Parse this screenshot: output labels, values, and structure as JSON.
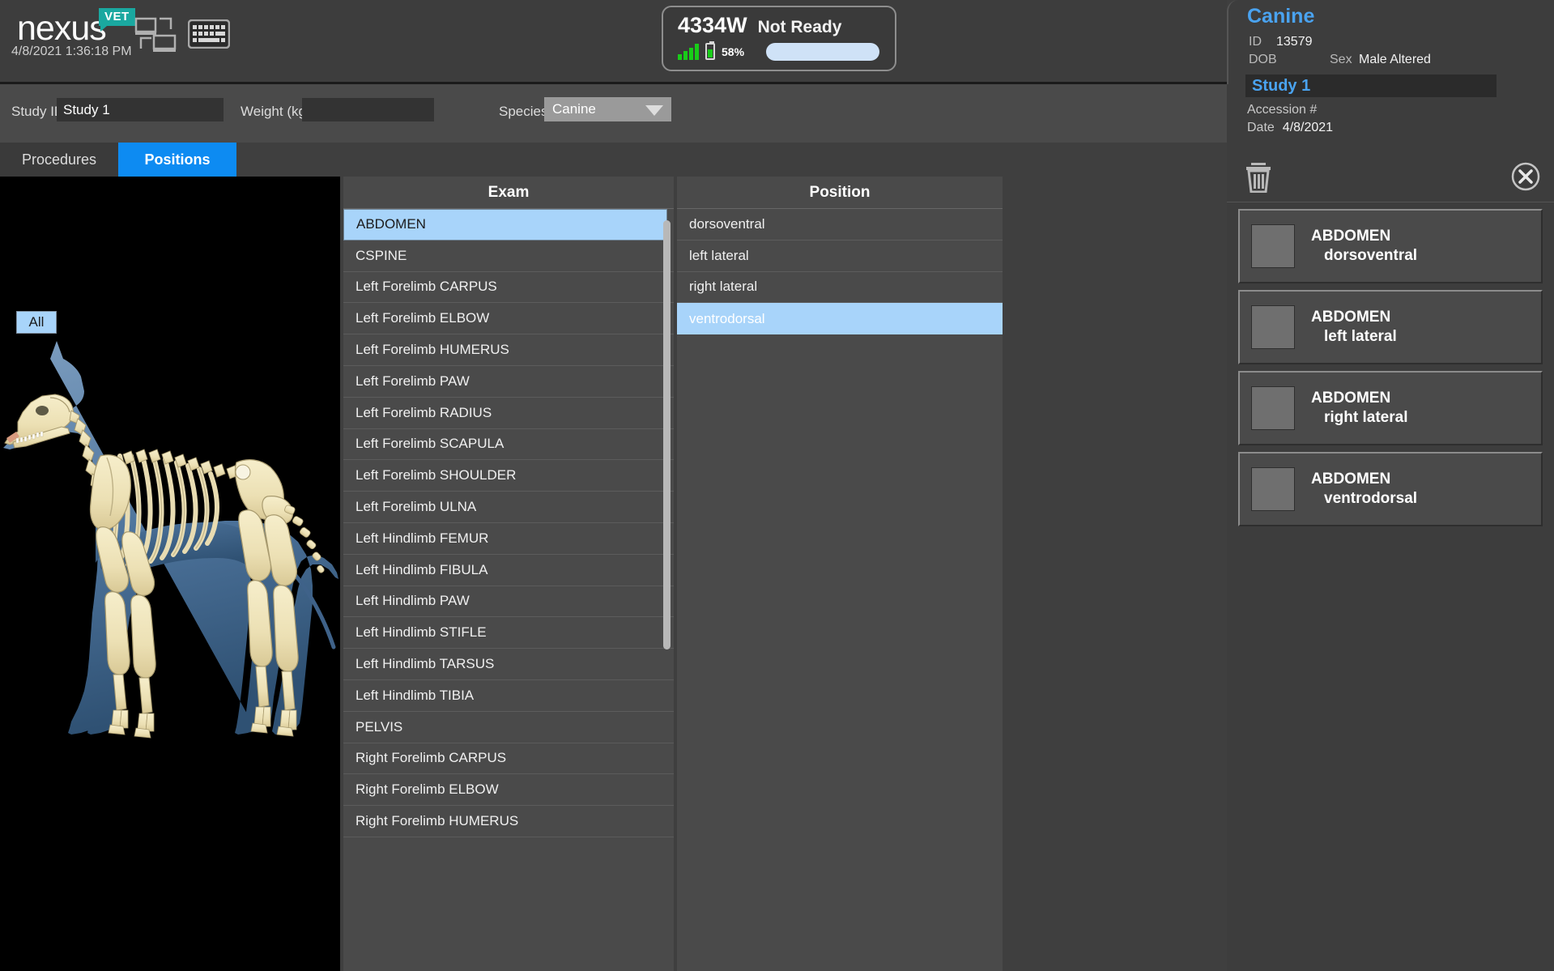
{
  "app": {
    "brand_name": "nexus",
    "brand_badge": "VET",
    "datetime": "4/8/2021 1:36:18 PM",
    "accent_blue": "#0d8bf2",
    "selection_blue": "#a8d4fa",
    "panel_gray": "#4a4a4a"
  },
  "toolbar_icons": {
    "network": "network-icon",
    "keyboard": "keyboard-icon"
  },
  "detector": {
    "id": "4334W",
    "status": "Not Ready",
    "signal_icon": "signal-bars-icon",
    "battery_icon": "battery-icon",
    "battery_percent": "58%",
    "battery_level": 58,
    "progress_color": "#cfe2f7"
  },
  "study_form": {
    "study_id_label": "Study ID",
    "study_id_value": "Study 1",
    "weight_label": "Weight (kg)",
    "weight_value": "",
    "weight_placeholder": "",
    "species_label": "Species",
    "species_value": "Canine",
    "species_caret_icon": "chevron-down-icon"
  },
  "tabs": {
    "procedures": "Procedures",
    "positions": "Positions",
    "active": "Positions"
  },
  "viewer": {
    "all_button": "All",
    "anatomy_model": "canine-skeleton-lateral"
  },
  "exam_column": {
    "header": "Exam",
    "selected": "ABDOMEN",
    "rows": [
      "ABDOMEN",
      "CSPINE",
      "Left Forelimb CARPUS",
      "Left Forelimb ELBOW",
      "Left Forelimb HUMERUS",
      "Left Forelimb PAW",
      "Left Forelimb RADIUS",
      "Left Forelimb SCAPULA",
      "Left Forelimb SHOULDER",
      "Left Forelimb ULNA",
      "Left Hindlimb FEMUR",
      "Left Hindlimb FIBULA",
      "Left Hindlimb PAW",
      "Left Hindlimb STIFLE",
      "Left Hindlimb TARSUS",
      "Left Hindlimb TIBIA",
      "PELVIS",
      "Right Forelimb CARPUS",
      "Right Forelimb ELBOW",
      "Right Forelimb HUMERUS"
    ]
  },
  "position_column": {
    "header": "Position",
    "selected": "ventrodorsal",
    "rows": [
      "dorsoventral",
      "left lateral",
      "right lateral",
      "ventrodorsal"
    ]
  },
  "patient": {
    "name": "Canine",
    "id_label": "ID",
    "id_value": "13579",
    "dob_label": "DOB",
    "dob_value": "",
    "sex_label": "Sex",
    "sex_value": "Male Altered"
  },
  "study_card": {
    "title": "Study 1",
    "accession_label": "Accession #",
    "accession_value": "",
    "date_label": "Date",
    "date_value": "4/8/2021",
    "dropdown_icon": "chevron-down-circle-icon",
    "new_study_icon": "add-study-icon"
  },
  "queue": {
    "trash_icon": "trash-icon",
    "close_icon": "close-circle-icon",
    "items": [
      {
        "exam": "ABDOMEN",
        "position": "dorsoventral"
      },
      {
        "exam": "ABDOMEN",
        "position": "left lateral"
      },
      {
        "exam": "ABDOMEN",
        "position": "right lateral"
      },
      {
        "exam": "ABDOMEN",
        "position": "ventrodorsal"
      }
    ]
  }
}
